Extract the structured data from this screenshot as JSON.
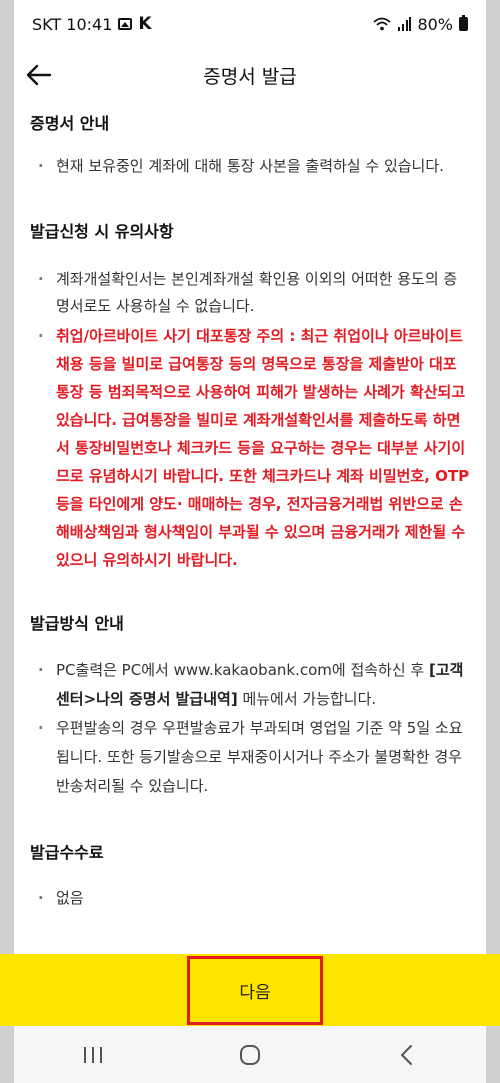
{
  "status_bar": {
    "carrier_time": "SKT 10:41",
    "k_badge": "K",
    "battery": "80%"
  },
  "header": {
    "title": "증명서 발급"
  },
  "sections": {
    "guide": {
      "title": "증명서 안내",
      "items": [
        "현재 보유중인 계좌에 대해 통장 사본을 출력하실 수 있습니다."
      ]
    },
    "notice": {
      "title": "발급신청 시 유의사항",
      "item1": "계좌개설확인서는 본인계좌개설 확인용 이외의 어떠한 용도의 증명서로도 사용하실 수 없습니다.",
      "warning": "취업/아르바이트 사기 대포통장 주의 : 최근 취업이나 아르바이트 채용 등을 빌미로 급여통장 등의 명목으로 통장을 제출받아 대포통장 등 범죄목적으로 사용하여 피해가 발생하는 사례가 확산되고 있습니다. 급여통장을 빌미로 계좌개설확인서를 제출하도록 하면서 통장비밀번호나 체크카드 등을 요구하는 경우는 대부분 사기이므로 유념하시기 바랍니다. 또한 체크카드나 계좌 비밀번호, OTP등을 타인에게 양도· 매매하는 경우, 전자금융거래법 위반으로 손해배상책임과 형사책임이 부과될 수 있으며 금융거래가 제한될 수 있으니 유의하시기 바랍니다."
    },
    "method": {
      "title": "발급방식 안내",
      "pc_prefix": "PC출력은 PC에서 www.kakaobank.com에 접속하신 후",
      "pc_menu": "[고객센터>나의 증명서 발급내역]",
      "pc_suffix": " 메뉴에서 가능합니다.",
      "mail": "우편발송의 경우 우편발송료가 부과되며 영업일 기준 약 5일 소요됩니다. 또한 등기발송으로 부재중이시거나 주소가 불명확한 경우 반송처리될 수 있습니다."
    },
    "fee": {
      "title": "발급수수료",
      "items": [
        "없음"
      ]
    }
  },
  "buttons": {
    "next": "다음"
  },
  "colors": {
    "accent_yellow": "#fee500",
    "warning_red": "#e31b23"
  }
}
